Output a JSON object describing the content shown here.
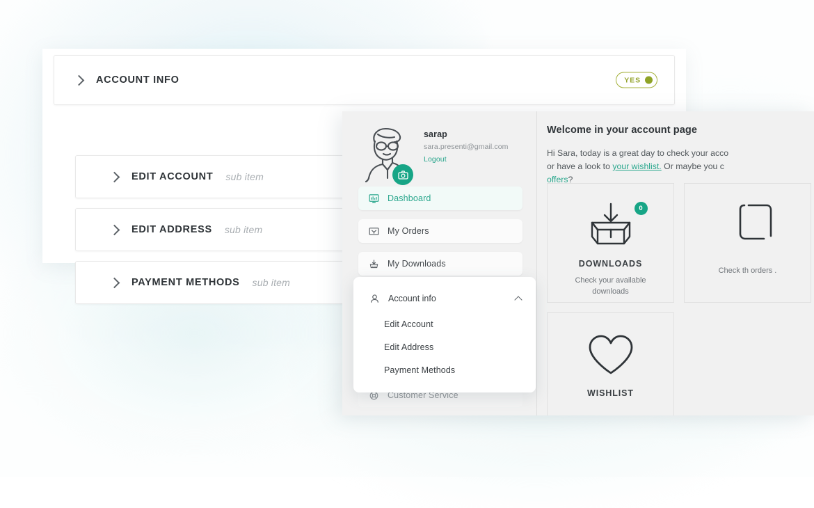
{
  "accordion": {
    "main": {
      "label": "ACCOUNT INFO",
      "toggle": {
        "label": "YES",
        "state": "on",
        "border_color": "#a4b13a",
        "text_color": "#96a531",
        "dot_color": "#8fa326"
      }
    },
    "sub_items": [
      {
        "label": "EDIT ACCOUNT",
        "hint": "sub item"
      },
      {
        "label": "EDIT ADDRESS",
        "hint": "sub item"
      },
      {
        "label": "PAYMENT METHODS",
        "hint": "sub item"
      }
    ]
  },
  "dashboard": {
    "profile": {
      "name": "sarap",
      "email": "sara.presenti@gmail.com",
      "logout": "Logout",
      "avatar_icon": "person-avatar-icon",
      "badge_icon": "camera-icon",
      "badge_color": "#17a586"
    },
    "nav": [
      {
        "label": "Dashboard",
        "icon": "dashboard-icon",
        "active": true
      },
      {
        "label": "My Orders",
        "icon": "orders-box-icon",
        "active": false
      },
      {
        "label": "My Downloads",
        "icon": "downloads-icon",
        "active": false
      }
    ],
    "account_card": {
      "label": "Account info",
      "icon": "person-icon",
      "chevron": "chevron-up-icon",
      "sub_items": [
        {
          "label": "Edit Account"
        },
        {
          "label": "Edit Address"
        },
        {
          "label": "Payment Methods"
        }
      ]
    },
    "customer_service": {
      "label": "Customer Service",
      "icon": "support-icon"
    },
    "welcome": {
      "title": "Welcome in your account page",
      "body_part1": "Hi Sara, today is a great day to check your acco",
      "body_part2": "or have a look to ",
      "link1": "your wishlist.",
      "body_part3": " Or maybe you c",
      "link2": "offers",
      "body_part4": "?"
    },
    "tiles": [
      {
        "title": "DOWNLOADS",
        "desc": "Check your available downloads",
        "icon": "download-box-icon",
        "badge": "0",
        "badge_color": "#17a586"
      },
      {
        "title": "",
        "desc": "Check th\norders .",
        "icon": "orders-clipped-icon",
        "badge": "",
        "badge_color": ""
      },
      {
        "title": "WISHLIST",
        "desc": "",
        "icon": "heart-icon",
        "badge": "",
        "badge_color": ""
      }
    ]
  },
  "theme": {
    "accent_teal": "#2aa78d",
    "accent_olive": "#96a531",
    "panel_bg": "#f1f1f1",
    "card_bg": "#ffffff"
  }
}
